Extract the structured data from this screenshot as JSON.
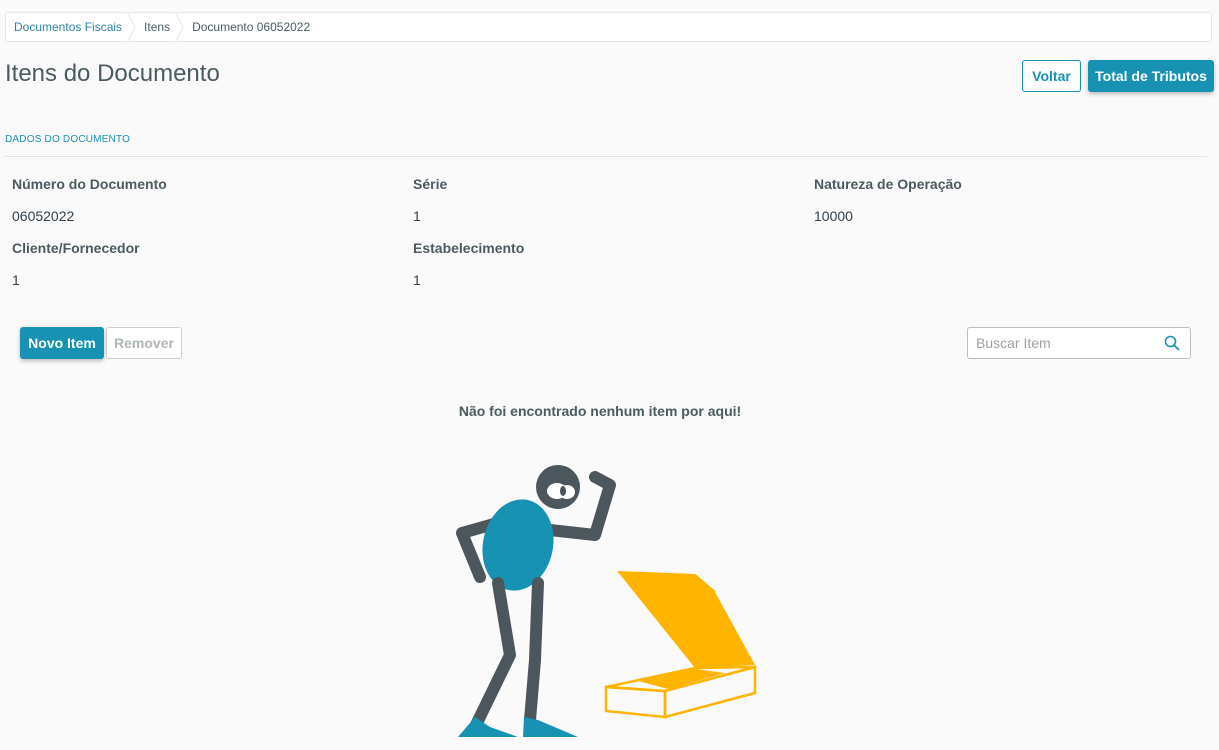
{
  "breadcrumb": {
    "items": [
      "Documentos Fiscais",
      "Itens",
      "Documento 06052022"
    ]
  },
  "page": {
    "title": "Itens do Documento"
  },
  "header_actions": {
    "back_label": "Voltar",
    "taxes_label": "Total de Tributos"
  },
  "document": {
    "section_title": "DADOS DO DOCUMENTO",
    "fields": [
      {
        "label": "Número do Documento",
        "value": "06052022"
      },
      {
        "label": "Série",
        "value": "1"
      },
      {
        "label": "Natureza de Operação",
        "value": "10000"
      },
      {
        "label": "Cliente/Fornecedor",
        "value": "1"
      },
      {
        "label": "Estabelecimento",
        "value": "1"
      }
    ]
  },
  "items_toolbar": {
    "new_label": "Novo Item",
    "remove_label": "Remover",
    "search_placeholder": "Buscar Item"
  },
  "empty_state": {
    "message": "Não foi encontrado nenhum item por aqui!"
  },
  "colors": {
    "primary": "#1792b3",
    "box": "#ffb500",
    "figure_dark": "#4b575c"
  }
}
